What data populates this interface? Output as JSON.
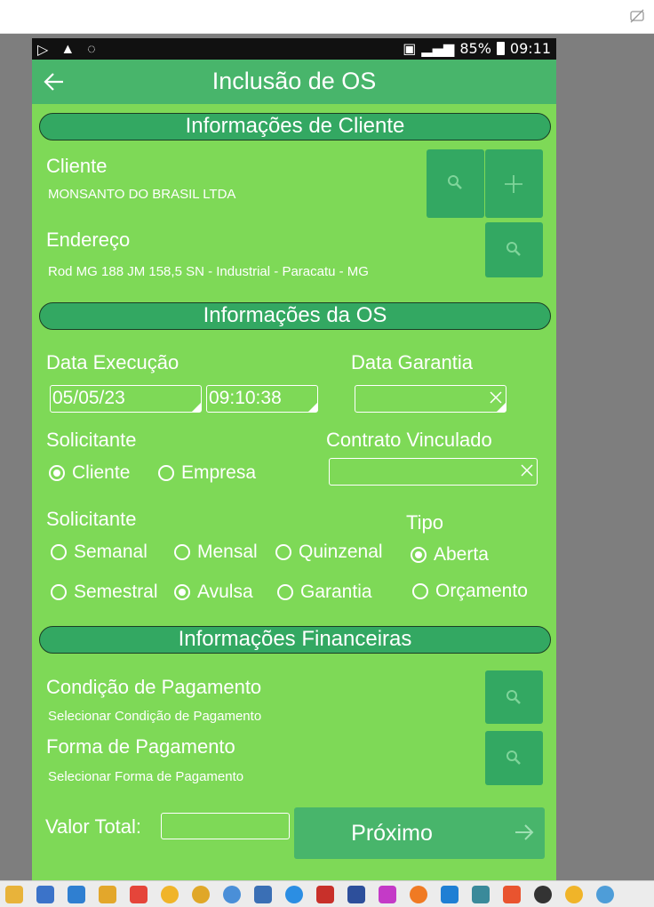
{
  "status_bar": {
    "battery": "85%",
    "time": "09:11"
  },
  "app_bar": {
    "title": "Inclusão de OS"
  },
  "sections": {
    "client": "Informações de Cliente",
    "os": "Informações da OS",
    "financial": "Informações Financeiras"
  },
  "client": {
    "label": "Cliente",
    "value": "MONSANTO DO BRASIL LTDA",
    "address_label": "Endereço",
    "address_value": "Rod MG 188 JM 158,5 SN - Industrial - Paracatu - MG"
  },
  "os": {
    "exec_label": "Data Execução",
    "exec_date": "05/05/23",
    "exec_time": "09:10:38",
    "warranty_label": "Data Garantia",
    "warranty_value": "",
    "requester_label": "Solicitante",
    "requester_options": [
      {
        "label": "Cliente",
        "checked": true
      },
      {
        "label": "Empresa",
        "checked": false
      }
    ],
    "contract_label": "Contrato Vinculado",
    "contract_value": "",
    "frequency_label": "Solicitante",
    "frequency_options": [
      {
        "label": "Semanal",
        "checked": false
      },
      {
        "label": "Mensal",
        "checked": false
      },
      {
        "label": "Quinzenal",
        "checked": false
      },
      {
        "label": "Semestral",
        "checked": false
      },
      {
        "label": "Avulsa",
        "checked": true
      },
      {
        "label": "Garantia",
        "checked": false
      }
    ],
    "type_label": "Tipo",
    "type_options": [
      {
        "label": "Aberta",
        "checked": true
      },
      {
        "label": "Orçamento",
        "checked": false
      }
    ]
  },
  "financial": {
    "condition_label": "Condição de Pagamento",
    "condition_value": "Selecionar Condição de Pagamento",
    "method_label": "Forma de Pagamento",
    "method_value": "Selecionar Forma de Pagamento",
    "total_label": "Valor Total:",
    "total_value": "",
    "next_label": "Próximo"
  },
  "colors": {
    "background": "#7ed957",
    "app_bar": "#48b56b",
    "section_header": "#33a862",
    "button": "#33a862"
  },
  "taskbar_icons": [
    "file-explorer-icon",
    "tools-icon",
    "mail-icon",
    "app-icon",
    "remote-icon",
    "chrome-icon",
    "mf-icon",
    "chrome-profile-icon",
    "notepad-icon",
    "ie-icon",
    "filezilla-icon",
    "network-icon",
    "app-purple-icon",
    "firefox-icon",
    "vscode-icon",
    "pen-icon",
    "brave-icon",
    "settings-icon",
    "chrome-alt-icon",
    "app-alt-icon"
  ]
}
